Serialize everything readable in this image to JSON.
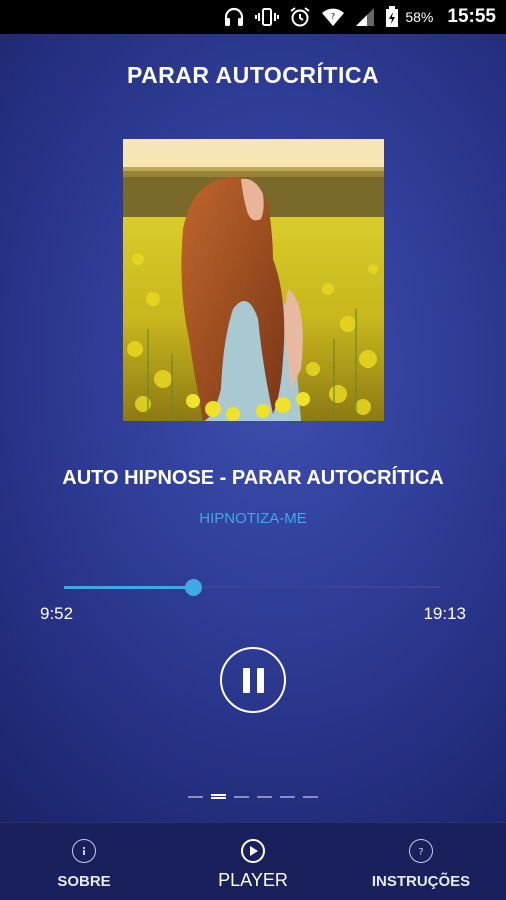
{
  "status_bar": {
    "icons": [
      "headphones-icon",
      "vibrate-icon",
      "alarm-icon",
      "wifi-icon",
      "cell-signal-icon",
      "battery-charging-icon"
    ],
    "battery": "58%",
    "time": "15:55"
  },
  "header": {
    "title": "PARAR AUTOCRÍTICA"
  },
  "player": {
    "track_title": "AUTO HIPNOSE - PARAR AUTOCRÍTICA",
    "artist": "HIPNOTIZA-ME",
    "elapsed": "9:52",
    "total": "19:13",
    "progress": 0.342,
    "state": "playing",
    "accent_color": "#3fa9e6"
  },
  "pager": {
    "count": 6,
    "active_index": 1
  },
  "bottom_nav": {
    "items": [
      {
        "label": "SOBRE",
        "icon": "info-icon"
      },
      {
        "label": "PLAYER",
        "icon": "play-icon"
      },
      {
        "label": "INSTRUÇÕES",
        "icon": "help-icon"
      }
    ],
    "active_index": 1
  }
}
